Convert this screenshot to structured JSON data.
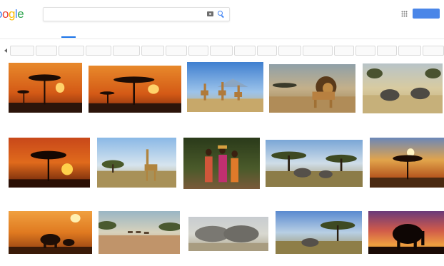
{
  "search": {
    "query": "",
    "placeholder": ""
  },
  "logo": {
    "text": "oogle",
    "colors": [
      "#4285f4",
      "#ea4335",
      "#fbbc05",
      "#4285f4",
      "#34a853",
      "#ea4335"
    ]
  },
  "header": {
    "signin_label": "",
    "accent": "#4a86e8"
  },
  "tabs": [
    "",
    "",
    "",
    "",
    "",
    "",
    "",
    ""
  ],
  "chips": [
    "",
    "",
    "",
    "",
    "",
    "",
    "",
    "",
    "",
    "",
    "",
    "",
    "",
    "",
    "",
    "",
    "",
    "",
    ""
  ],
  "results": [
    {
      "caption": "",
      "source": "",
      "scene": "sunset-acacia"
    },
    {
      "caption": "",
      "source": "",
      "scene": "sunset-acacia"
    },
    {
      "caption": "",
      "source": "",
      "scene": "giraffe-sky"
    },
    {
      "caption": "",
      "source": "",
      "scene": "lion"
    },
    {
      "caption": "",
      "source": "",
      "scene": "rhino"
    },
    {
      "caption": "",
      "source": "",
      "scene": "sunset-tree"
    },
    {
      "caption": "",
      "source": "",
      "scene": "giraffe-savanna"
    },
    {
      "caption": "",
      "source": "",
      "scene": "women"
    },
    {
      "caption": "",
      "source": "",
      "scene": "elephant-savanna"
    },
    {
      "caption": "",
      "source": "",
      "scene": "sunset-acacia-2"
    },
    {
      "caption": "",
      "source": "",
      "scene": "elephant-sunset"
    },
    {
      "caption": "",
      "source": "",
      "scene": "antelope-plain"
    },
    {
      "caption": "",
      "source": "",
      "scene": "elephant-herd"
    },
    {
      "caption": "",
      "source": "",
      "scene": "elephant-savanna-2"
    },
    {
      "caption": "",
      "source": "",
      "scene": "elephant-silhouette"
    }
  ]
}
